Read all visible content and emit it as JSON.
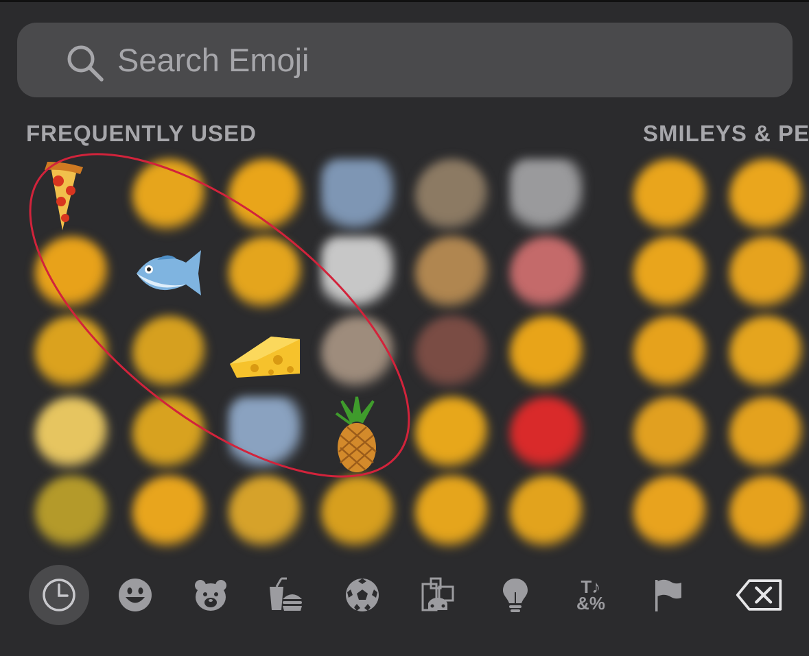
{
  "search": {
    "placeholder": "Search Emoji",
    "value": ""
  },
  "sections": {
    "frequently_used": "FREQUENTLY USED",
    "smileys": "SMILEYS & PE"
  },
  "grid": [
    [
      "pizza",
      "#e6a51c",
      "#e9a51a",
      "#7e96b4",
      "#8c7a63",
      "#9a9a9c",
      "",
      "#e9a51c",
      "#eaa61d"
    ],
    [
      "#e8a21a",
      "fish",
      "#e4a51d",
      "#c7c7c7",
      "#b08650",
      "#c46a6a",
      "",
      "#e9a51c",
      "#e6a31e"
    ],
    [
      "#dba21e",
      "#d6a01f",
      "cheese",
      "#9e8c7c",
      "#7a4c44",
      "#e8a419",
      "",
      "#e6a21c",
      "#e5a51e"
    ],
    [
      "#e6c560",
      "#d8a21f",
      "#8aa2c0",
      "pineapple",
      "#e7a71b",
      "#d92a2a",
      "",
      "#e1a020",
      "#e4a21e"
    ],
    [
      "#b49a2a",
      "#e8a51d",
      "#d6a22a",
      "#d79f1e",
      "#e5a51c",
      "#e2a31d",
      "",
      "#e8a31e",
      "#e6a21d"
    ]
  ],
  "categories": [
    {
      "name": "recents-icon",
      "selected": true
    },
    {
      "name": "smileys-icon",
      "selected": false
    },
    {
      "name": "animals-icon",
      "selected": false
    },
    {
      "name": "food-icon",
      "selected": false
    },
    {
      "name": "activity-icon",
      "selected": false
    },
    {
      "name": "travel-icon",
      "selected": false
    },
    {
      "name": "objects-icon",
      "selected": false
    },
    {
      "name": "symbols-icon",
      "selected": false
    },
    {
      "name": "flags-icon",
      "selected": false
    }
  ],
  "symbols_icon_text": {
    "top": "T♪",
    "bottom": "&%"
  },
  "colors": {
    "background": "#2b2b2d",
    "search_bg": "#4a4a4c",
    "annotation": "#d2233b",
    "icon": "#9c9ca0"
  }
}
